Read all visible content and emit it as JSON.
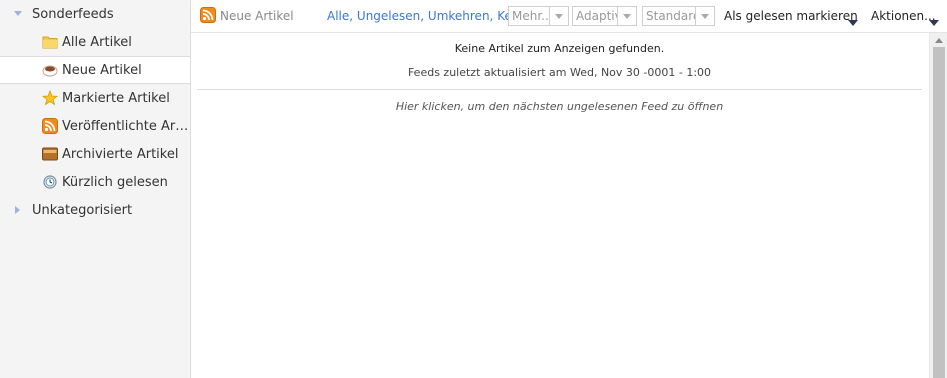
{
  "sidebar": {
    "categories": [
      {
        "label": "Sonderfeeds",
        "expanded": true
      },
      {
        "label": "Unkategorisiert",
        "expanded": false
      }
    ],
    "feeds": [
      {
        "label": "Alle Artikel",
        "icon": "folder-icon"
      },
      {
        "label": "Neue Artikel",
        "icon": "coffee-cup-icon",
        "selected": true
      },
      {
        "label": "Markierte Artikel",
        "icon": "star-icon"
      },
      {
        "label": "Veröffentlichte Artikel",
        "icon": "rss-icon"
      },
      {
        "label": "Archivierte Artikel",
        "icon": "archive-box-icon"
      },
      {
        "label": "Kürzlich gelesen",
        "icon": "clock-icon"
      }
    ]
  },
  "toolbar": {
    "feed_title": "Neue Artikel",
    "select_links": [
      "Alle",
      "Ungelesen",
      "Umkehren",
      "Keine"
    ],
    "more_select": "Mehr...",
    "view_select": "Adaptiv",
    "order_select": "Standard",
    "mark_read": "Als gelesen markieren",
    "actions": "Aktionen..."
  },
  "content": {
    "no_articles": "Keine Artikel zum Anzeigen gefunden.",
    "last_updated": "Feeds zuletzt aktualisiert am Wed, Nov 30 -0001 - 1:00",
    "next_feed": "Hier klicken, um den nächsten ungelesenen Feed zu öffnen"
  },
  "colors": {
    "link": "#3a76d6",
    "sidebar_bg": "#f4f4f4",
    "rss_orange": "#f28a1d"
  }
}
